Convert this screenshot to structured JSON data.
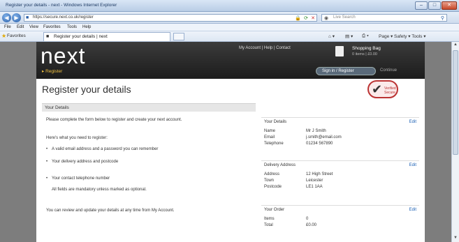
{
  "browser": {
    "title": "Register your details - next - Windows Internet Explorer",
    "address": "https://secure.next.co.uk/register",
    "search_placeholder": "Live Search",
    "menu": [
      "File",
      "Edit",
      "View",
      "Favorites",
      "Tools",
      "Help"
    ],
    "favorites_label": "Favorites",
    "tab_title": "Register your details | next",
    "command_bar": "Page ▾ Safety ▾ Tools ▾",
    "window_buttons": {
      "minimize": "–",
      "maximize": "□",
      "close": "✕"
    }
  },
  "site": {
    "logo": "next",
    "top_links": "My Account | Help | Contact",
    "bag_title": "Shopping Bag",
    "bag_sub": "0 items | £0.00",
    "breadcrumb": "▸ Register",
    "header_button": "Sign in / Register",
    "header_link": "Continue",
    "page_heading": "Register your details",
    "seal_text": "Verified\nSecure"
  },
  "main": {
    "section_title": "Your Details",
    "intro": "Please complete the form below to register and create your next account.",
    "lead": "Here's what you need to register:",
    "bullets": [
      "A valid email address and a password you can remember",
      "Your delivery address and postcode",
      "Your contact telephone number"
    ],
    "note": "All fields are mandatory unless marked as optional.",
    "footer_text": "You can review and update your details at any time from My Account."
  },
  "summary": {
    "box1": {
      "title": "Your Details",
      "edit": "Edit",
      "rows": [
        {
          "label": "Name",
          "value": "Mr J Smith"
        },
        {
          "label": "Email",
          "value": "j.smith@email.com"
        },
        {
          "label": "Telephone",
          "value": "01234 567890"
        }
      ]
    },
    "box2": {
      "title": "Delivery Address",
      "edit": "Edit",
      "rows": [
        {
          "label": "Address",
          "value": "12 High Street"
        },
        {
          "label": "Town",
          "value": "Leicester"
        },
        {
          "label": "Postcode",
          "value": "LE1 1AA"
        }
      ]
    },
    "box3": {
      "title": "Your Order",
      "edit": "Edit",
      "rows": [
        {
          "label": "Items",
          "value": "0"
        },
        {
          "label": "Total",
          "value": "£0.00"
        }
      ]
    }
  }
}
